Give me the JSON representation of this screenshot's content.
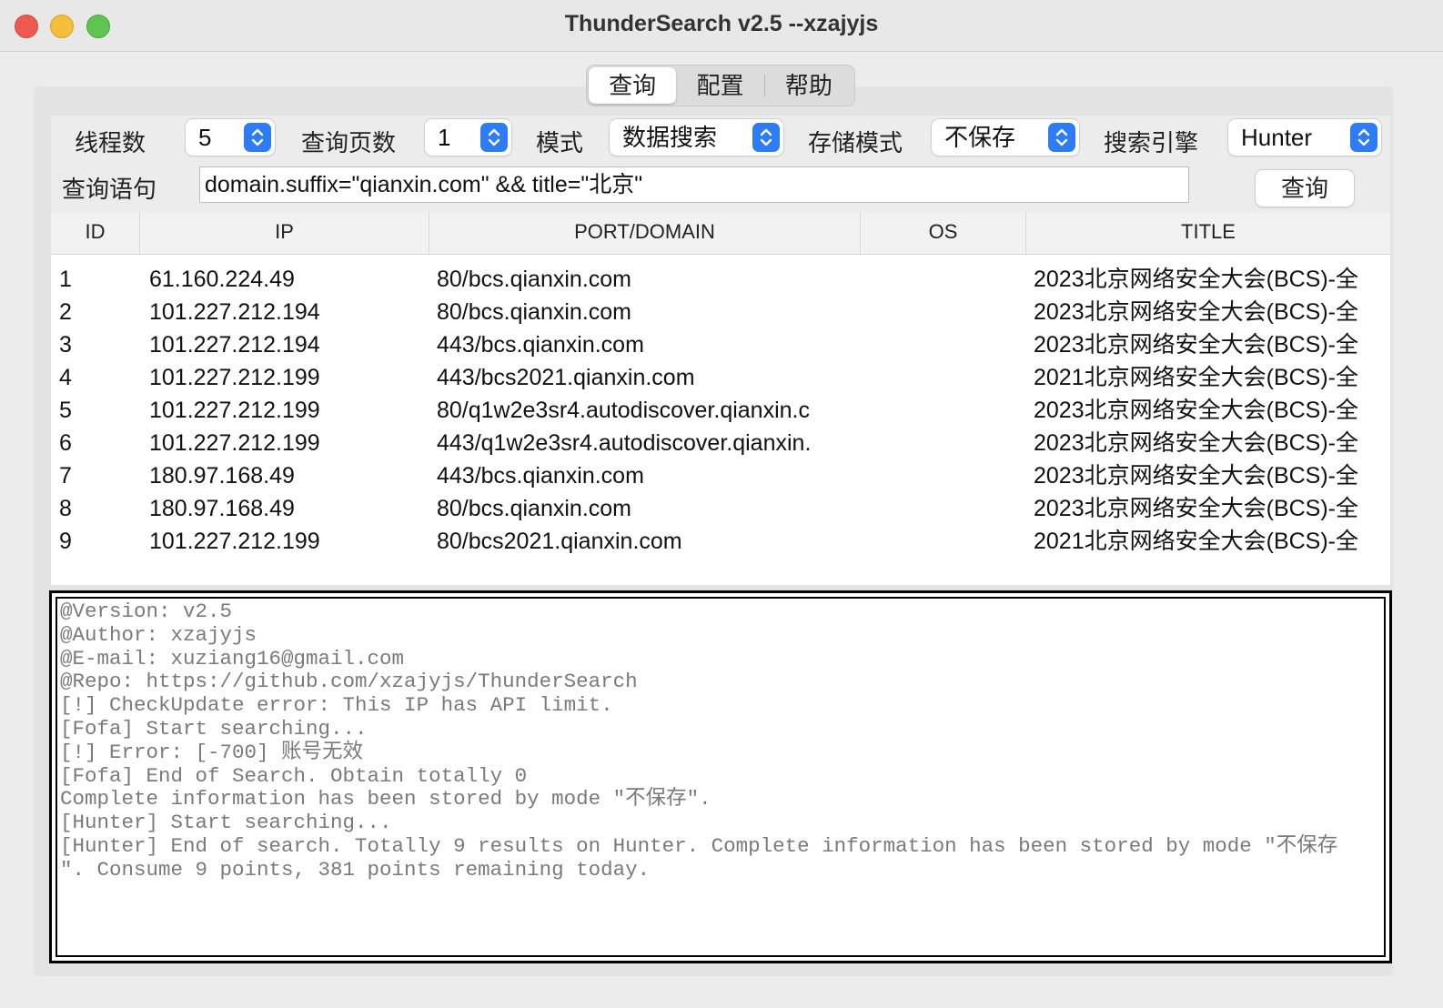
{
  "window": {
    "title": "ThunderSearch v2.5  --xzajyjs"
  },
  "tabs": [
    {
      "label": "查询",
      "active": true
    },
    {
      "label": "配置",
      "active": false
    },
    {
      "label": "帮助",
      "active": false
    }
  ],
  "form": {
    "threads_label": "线程数",
    "threads_value": "5",
    "pages_label": "查询页数",
    "pages_value": "1",
    "mode_label": "模式",
    "mode_value": "数据搜索",
    "storage_label": "存储模式",
    "storage_value": "不保存",
    "engine_label": "搜索引擎",
    "engine_value": "Hunter",
    "query_label": "查询语句",
    "query_value": "domain.suffix=\"qianxin.com\" && title=\"北京\"",
    "query_button": "查询"
  },
  "table": {
    "columns": [
      "ID",
      "IP",
      "PORT/DOMAIN",
      "OS",
      "TITLE"
    ],
    "rows": [
      [
        "1",
        "61.160.224.49",
        "80/bcs.qianxin.com",
        "",
        "2023北京网络安全大会(BCS)-全"
      ],
      [
        "2",
        "101.227.212.194",
        "80/bcs.qianxin.com",
        "",
        "2023北京网络安全大会(BCS)-全"
      ],
      [
        "3",
        "101.227.212.194",
        "443/bcs.qianxin.com",
        "",
        "2023北京网络安全大会(BCS)-全"
      ],
      [
        "4",
        "101.227.212.199",
        "443/bcs2021.qianxin.com",
        "",
        "2021北京网络安全大会(BCS)-全"
      ],
      [
        "5",
        "101.227.212.199",
        "80/q1w2e3sr4.autodiscover.qianxin.c",
        "",
        "2023北京网络安全大会(BCS)-全"
      ],
      [
        "6",
        "101.227.212.199",
        "443/q1w2e3sr4.autodiscover.qianxin.",
        "",
        "2023北京网络安全大会(BCS)-全"
      ],
      [
        "7",
        "180.97.168.49",
        "443/bcs.qianxin.com",
        "",
        "2023北京网络安全大会(BCS)-全"
      ],
      [
        "8",
        "180.97.168.49",
        "80/bcs.qianxin.com",
        "",
        "2023北京网络安全大会(BCS)-全"
      ],
      [
        "9",
        "101.227.212.199",
        "80/bcs2021.qianxin.com",
        "",
        "2021北京网络安全大会(BCS)-全"
      ]
    ]
  },
  "log": {
    "lines": [
      "@Version: v2.5",
      "@Author: xzajyjs",
      "@E-mail: xuziang16@gmail.com",
      "@Repo: https://github.com/xzajyjs/ThunderSearch",
      "[!] CheckUpdate error: This IP has API limit.",
      "[Fofa] Start searching...",
      "[!] Error: [-700] 账号无效",
      "[Fofa] End of Search. Obtain totally 0",
      "Complete information has been stored by mode \"不保存\".",
      "[Hunter] Start searching...",
      "[Hunter] End of search. Totally 9 results on Hunter. Complete information has been stored by mode \"不保存",
      "\". Consume 9 points, 381 points remaining today."
    ]
  }
}
